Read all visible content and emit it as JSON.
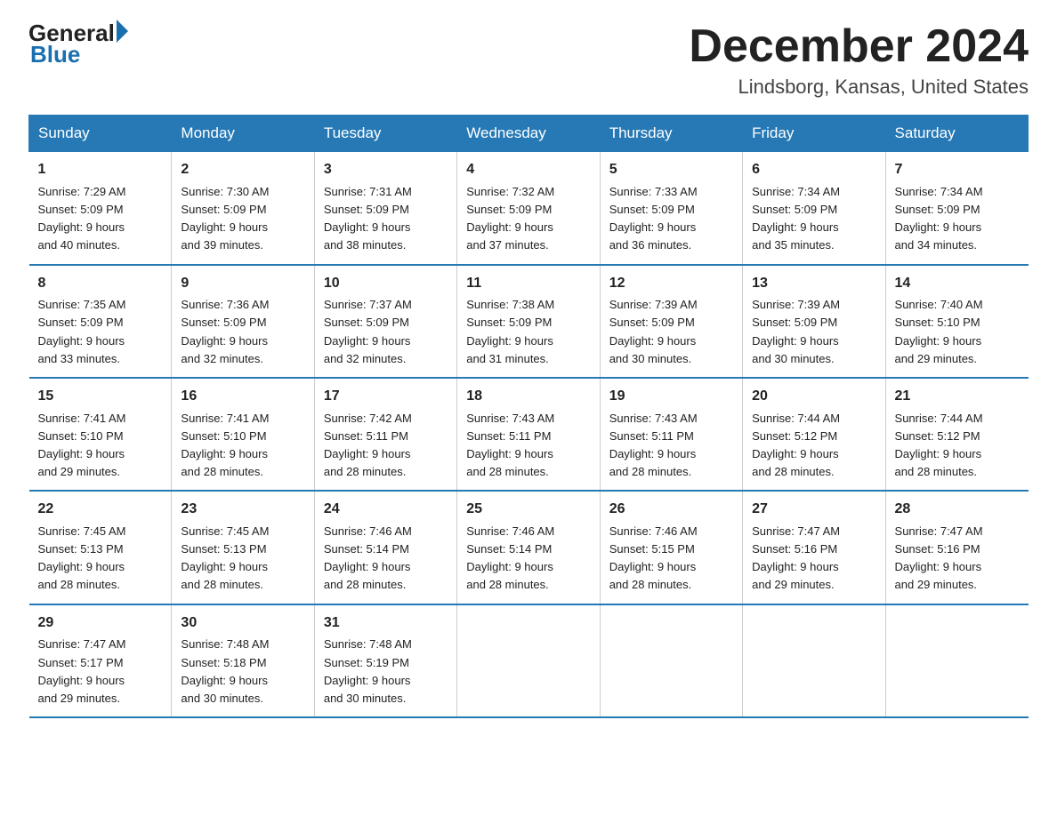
{
  "logo": {
    "general": "General",
    "blue": "Blue"
  },
  "title": "December 2024",
  "location": "Lindsborg, Kansas, United States",
  "days_of_week": [
    "Sunday",
    "Monday",
    "Tuesday",
    "Wednesday",
    "Thursday",
    "Friday",
    "Saturday"
  ],
  "weeks": [
    [
      {
        "day": "1",
        "sunrise": "7:29 AM",
        "sunset": "5:09 PM",
        "daylight": "9 hours and 40 minutes."
      },
      {
        "day": "2",
        "sunrise": "7:30 AM",
        "sunset": "5:09 PM",
        "daylight": "9 hours and 39 minutes."
      },
      {
        "day": "3",
        "sunrise": "7:31 AM",
        "sunset": "5:09 PM",
        "daylight": "9 hours and 38 minutes."
      },
      {
        "day": "4",
        "sunrise": "7:32 AM",
        "sunset": "5:09 PM",
        "daylight": "9 hours and 37 minutes."
      },
      {
        "day": "5",
        "sunrise": "7:33 AM",
        "sunset": "5:09 PM",
        "daylight": "9 hours and 36 minutes."
      },
      {
        "day": "6",
        "sunrise": "7:34 AM",
        "sunset": "5:09 PM",
        "daylight": "9 hours and 35 minutes."
      },
      {
        "day": "7",
        "sunrise": "7:34 AM",
        "sunset": "5:09 PM",
        "daylight": "9 hours and 34 minutes."
      }
    ],
    [
      {
        "day": "8",
        "sunrise": "7:35 AM",
        "sunset": "5:09 PM",
        "daylight": "9 hours and 33 minutes."
      },
      {
        "day": "9",
        "sunrise": "7:36 AM",
        "sunset": "5:09 PM",
        "daylight": "9 hours and 32 minutes."
      },
      {
        "day": "10",
        "sunrise": "7:37 AM",
        "sunset": "5:09 PM",
        "daylight": "9 hours and 32 minutes."
      },
      {
        "day": "11",
        "sunrise": "7:38 AM",
        "sunset": "5:09 PM",
        "daylight": "9 hours and 31 minutes."
      },
      {
        "day": "12",
        "sunrise": "7:39 AM",
        "sunset": "5:09 PM",
        "daylight": "9 hours and 30 minutes."
      },
      {
        "day": "13",
        "sunrise": "7:39 AM",
        "sunset": "5:09 PM",
        "daylight": "9 hours and 30 minutes."
      },
      {
        "day": "14",
        "sunrise": "7:40 AM",
        "sunset": "5:10 PM",
        "daylight": "9 hours and 29 minutes."
      }
    ],
    [
      {
        "day": "15",
        "sunrise": "7:41 AM",
        "sunset": "5:10 PM",
        "daylight": "9 hours and 29 minutes."
      },
      {
        "day": "16",
        "sunrise": "7:41 AM",
        "sunset": "5:10 PM",
        "daylight": "9 hours and 28 minutes."
      },
      {
        "day": "17",
        "sunrise": "7:42 AM",
        "sunset": "5:11 PM",
        "daylight": "9 hours and 28 minutes."
      },
      {
        "day": "18",
        "sunrise": "7:43 AM",
        "sunset": "5:11 PM",
        "daylight": "9 hours and 28 minutes."
      },
      {
        "day": "19",
        "sunrise": "7:43 AM",
        "sunset": "5:11 PM",
        "daylight": "9 hours and 28 minutes."
      },
      {
        "day": "20",
        "sunrise": "7:44 AM",
        "sunset": "5:12 PM",
        "daylight": "9 hours and 28 minutes."
      },
      {
        "day": "21",
        "sunrise": "7:44 AM",
        "sunset": "5:12 PM",
        "daylight": "9 hours and 28 minutes."
      }
    ],
    [
      {
        "day": "22",
        "sunrise": "7:45 AM",
        "sunset": "5:13 PM",
        "daylight": "9 hours and 28 minutes."
      },
      {
        "day": "23",
        "sunrise": "7:45 AM",
        "sunset": "5:13 PM",
        "daylight": "9 hours and 28 minutes."
      },
      {
        "day": "24",
        "sunrise": "7:46 AM",
        "sunset": "5:14 PM",
        "daylight": "9 hours and 28 minutes."
      },
      {
        "day": "25",
        "sunrise": "7:46 AM",
        "sunset": "5:14 PM",
        "daylight": "9 hours and 28 minutes."
      },
      {
        "day": "26",
        "sunrise": "7:46 AM",
        "sunset": "5:15 PM",
        "daylight": "9 hours and 28 minutes."
      },
      {
        "day": "27",
        "sunrise": "7:47 AM",
        "sunset": "5:16 PM",
        "daylight": "9 hours and 29 minutes."
      },
      {
        "day": "28",
        "sunrise": "7:47 AM",
        "sunset": "5:16 PM",
        "daylight": "9 hours and 29 minutes."
      }
    ],
    [
      {
        "day": "29",
        "sunrise": "7:47 AM",
        "sunset": "5:17 PM",
        "daylight": "9 hours and 29 minutes."
      },
      {
        "day": "30",
        "sunrise": "7:48 AM",
        "sunset": "5:18 PM",
        "daylight": "9 hours and 30 minutes."
      },
      {
        "day": "31",
        "sunrise": "7:48 AM",
        "sunset": "5:19 PM",
        "daylight": "9 hours and 30 minutes."
      },
      null,
      null,
      null,
      null
    ]
  ],
  "labels": {
    "sunrise": "Sunrise:",
    "sunset": "Sunset:",
    "daylight": "Daylight:"
  }
}
